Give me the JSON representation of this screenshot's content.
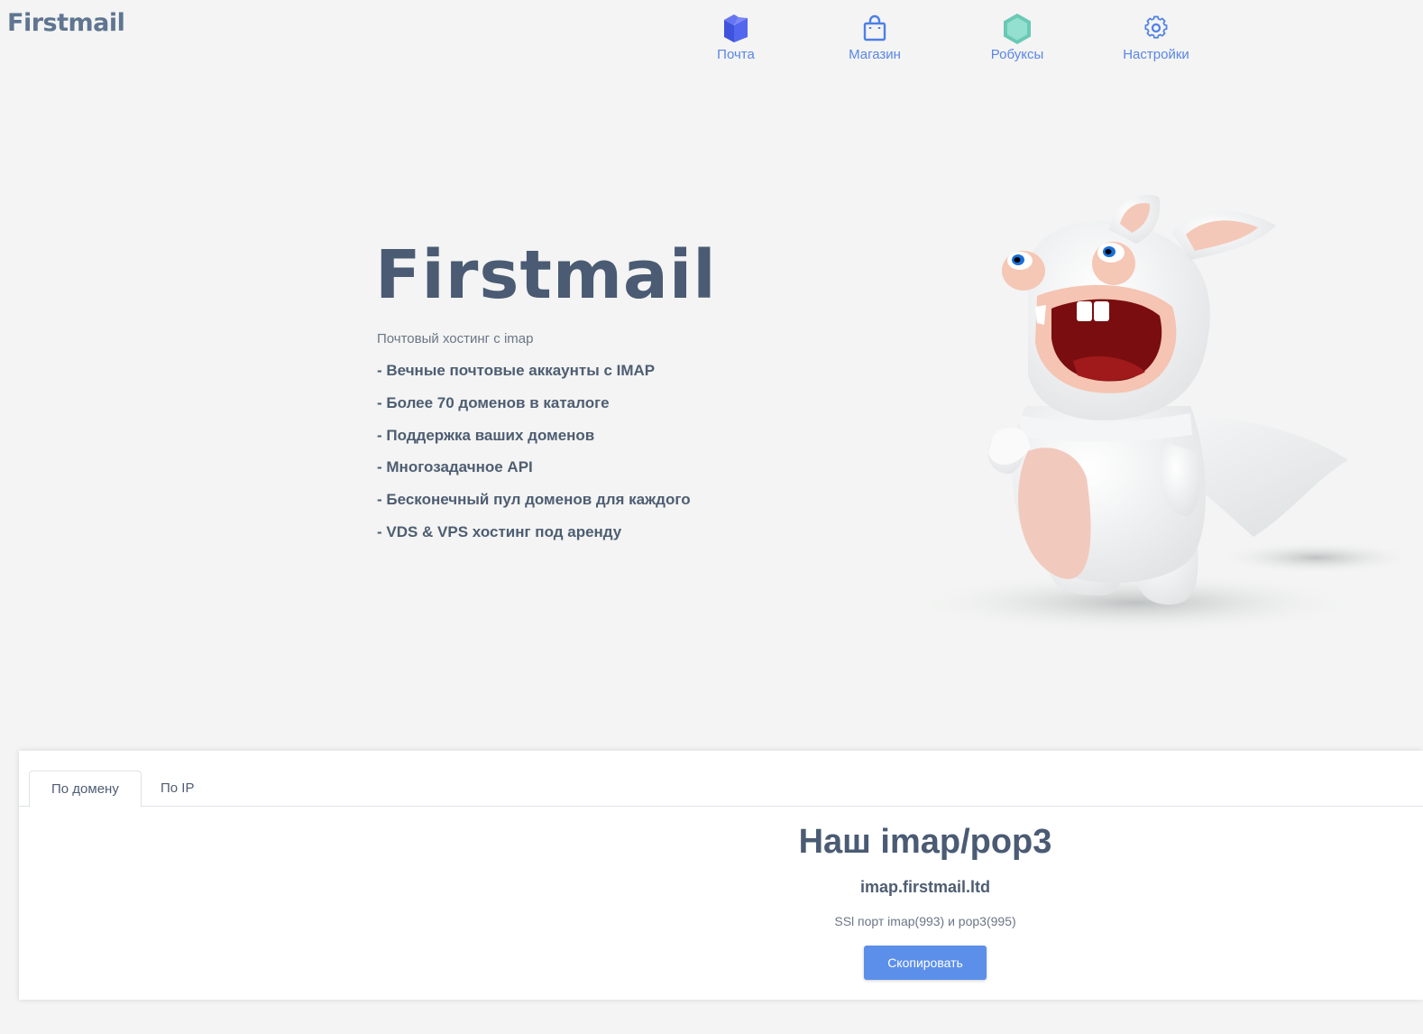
{
  "header": {
    "logo": "Firstmail"
  },
  "nav": {
    "items": [
      {
        "label": "Почта",
        "icon": "mail-cube-icon"
      },
      {
        "label": "Магазин",
        "icon": "shopping-bag-icon"
      },
      {
        "label": "Робуксы",
        "icon": "hexagon-icon"
      },
      {
        "label": "Настройки",
        "icon": "gear-icon"
      }
    ]
  },
  "hero": {
    "title": "Firstmail",
    "subtitle": "Почтовый хостинг с imap",
    "features": [
      "- Вечные почтовые аккаунты с IMAP",
      "- Более 70 доменов в каталоге",
      "- Поддержка ваших доменов",
      "- Многозадачное API",
      "- Бесконечный пул доменов для каждого",
      "- VDS & VPS хостинг под аренду"
    ]
  },
  "card": {
    "tabs": [
      {
        "label": "По домену",
        "active": true
      },
      {
        "label": "По IP",
        "active": false
      }
    ],
    "title": "Наш imap/pop3",
    "host": "imap.firstmail.ltd",
    "ports": "SSl порт imap(993) и pop3(995)",
    "copy_label": "Скопировать"
  },
  "colors": {
    "accent": "#5b8fe9",
    "nav_text": "#5b86e6",
    "heading": "#4a5b73",
    "background": "#f3f4f3",
    "mail_icon": "#4f5fe6",
    "robux_icon": "#7fd8c4"
  }
}
